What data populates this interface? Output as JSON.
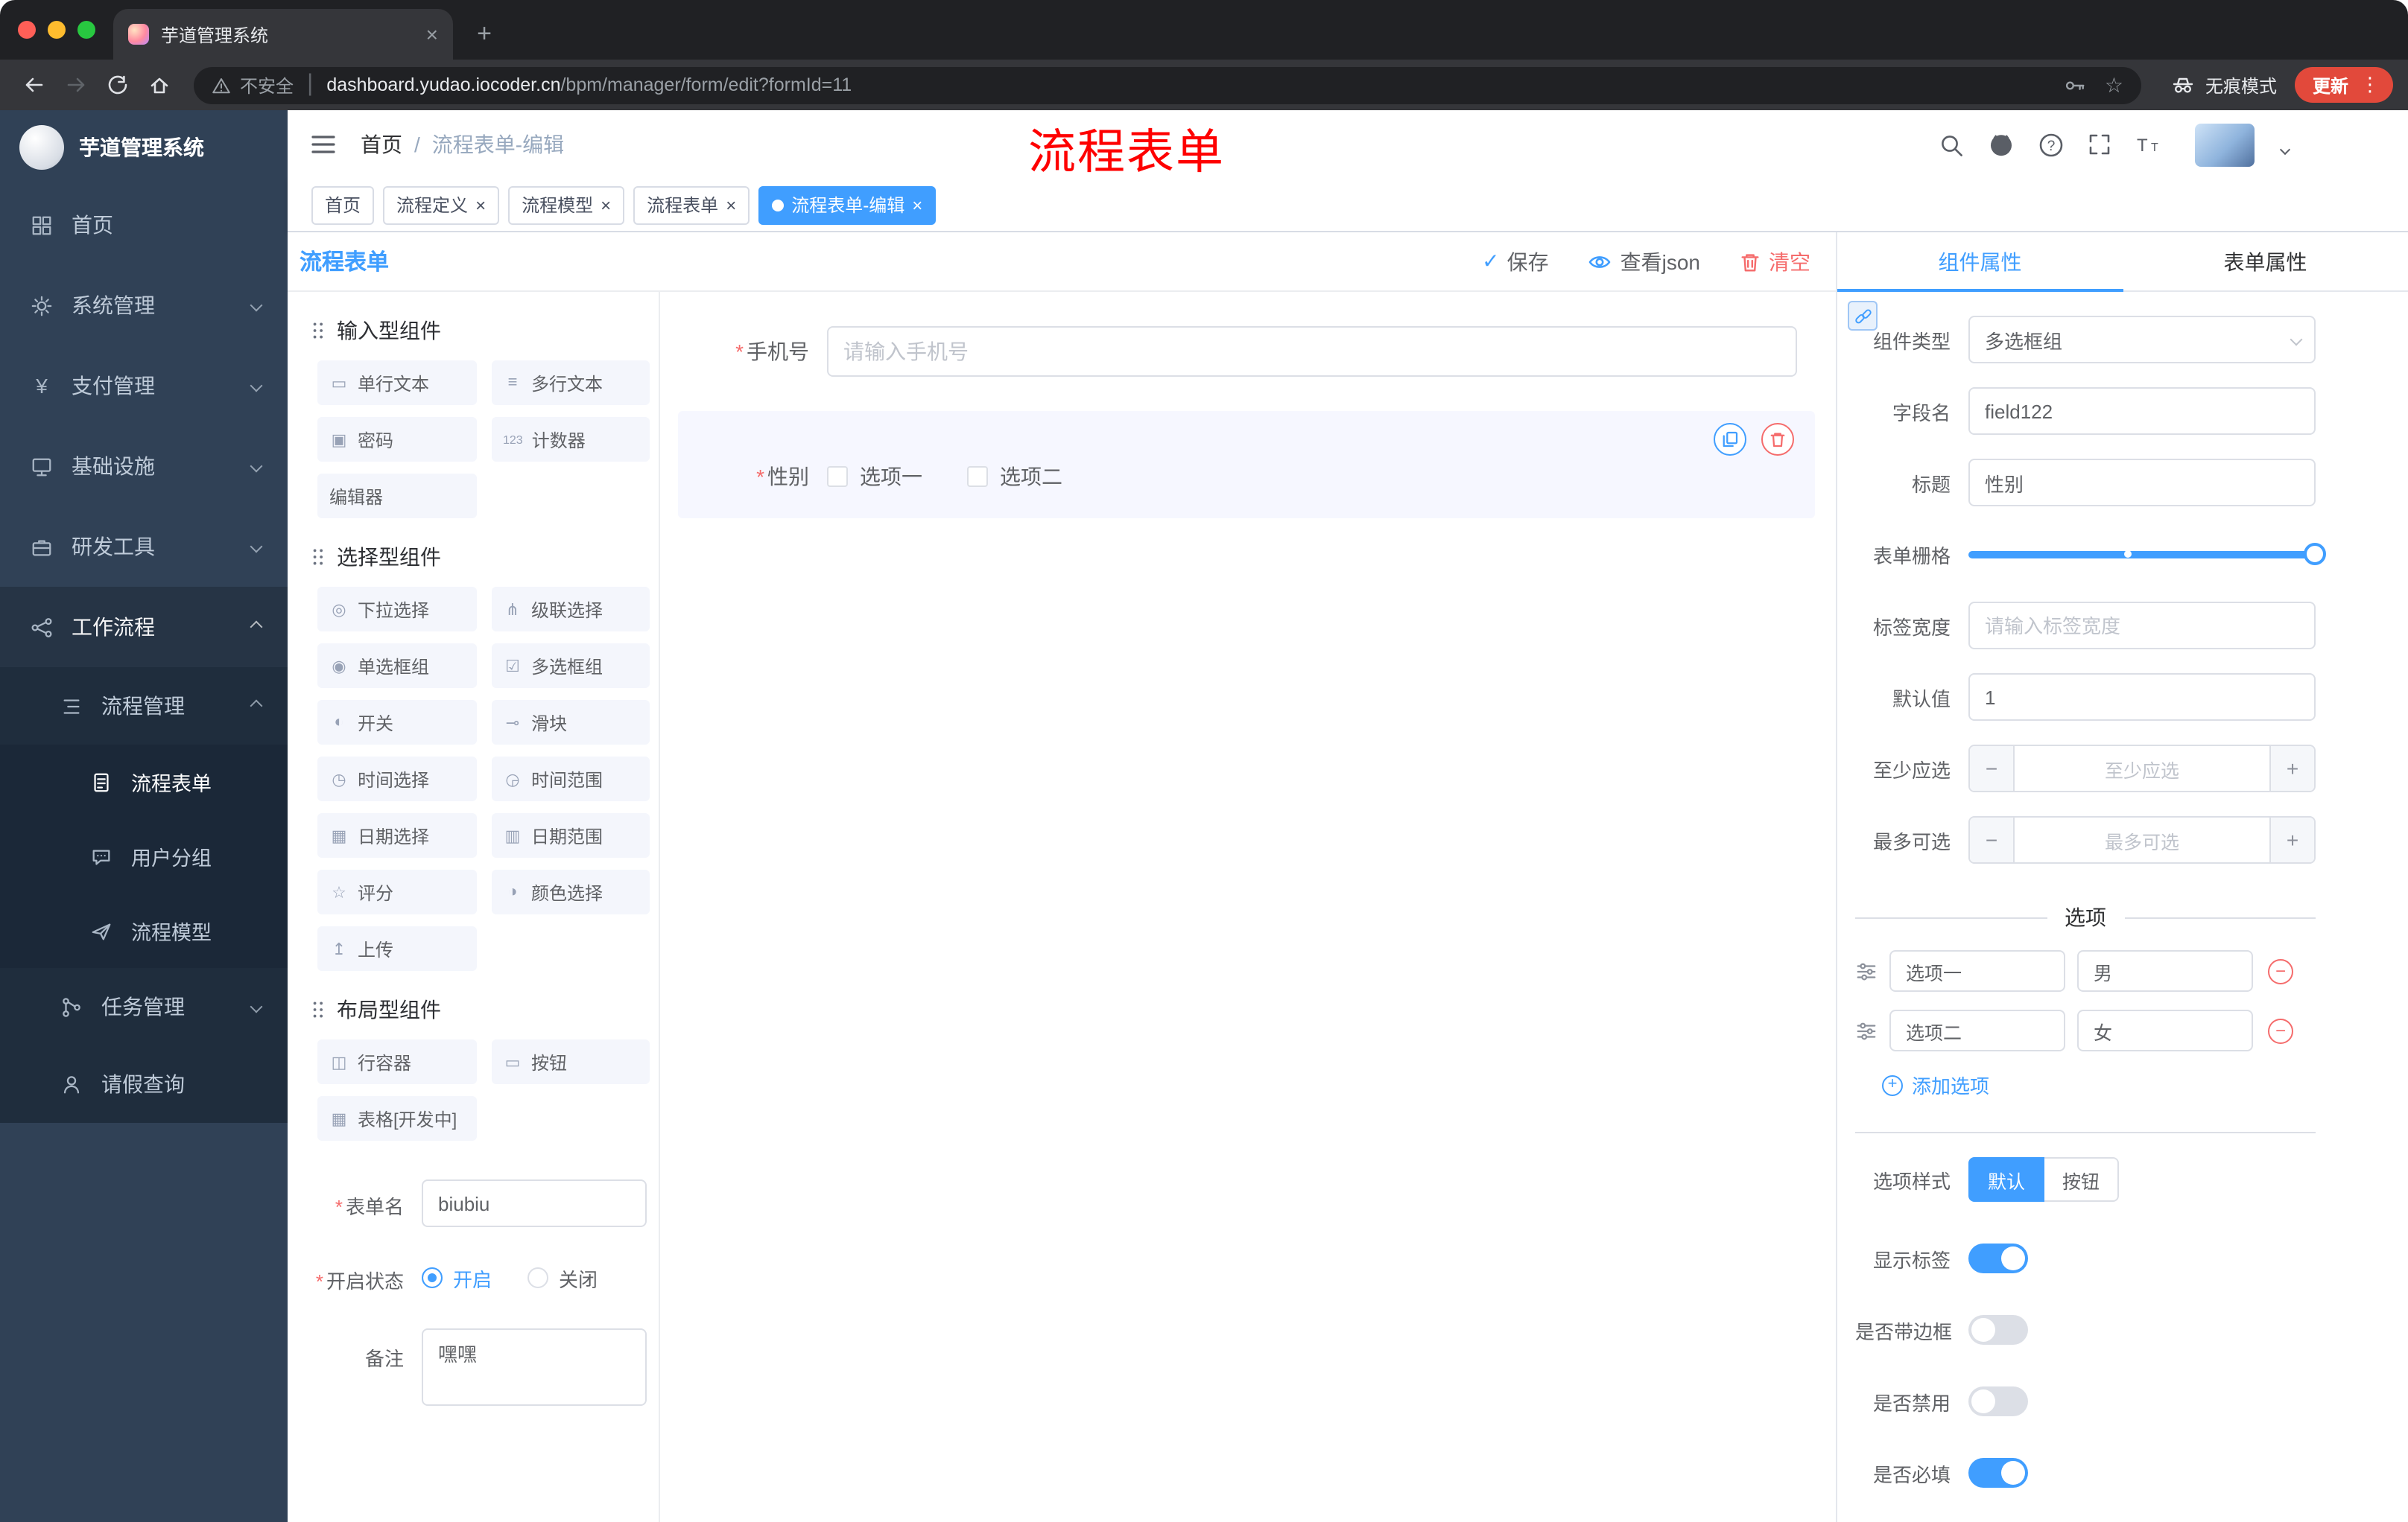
{
  "colors": {
    "accent": "#409EFF",
    "danger": "#F56C6C",
    "sidebar_bg": "#304156",
    "sidebar_sub_bg": "#1F2D3D",
    "update_button": "#E2493B",
    "annotation_red": "#FE0000",
    "selected_block_bg": "#F6F7FF"
  },
  "browser": {
    "tab_title": "芋道管理系统",
    "security_label": "不安全",
    "url_host": "dashboard.yudao.iocoder.cn",
    "url_path": "/bpm/manager/form/edit?formId=11",
    "incognito_label": "无痕模式",
    "update_label": "更新"
  },
  "sidebar": {
    "logo_title": "芋道管理系统",
    "items": [
      {
        "label": "首页",
        "icon": "dashboard"
      },
      {
        "label": "系统管理",
        "icon": "gear"
      },
      {
        "label": "支付管理",
        "icon": "yen"
      },
      {
        "label": "基础设施",
        "icon": "monitor"
      },
      {
        "label": "研发工具",
        "icon": "toolbox"
      },
      {
        "label": "工作流程",
        "icon": "workflow"
      },
      {
        "label": "流程管理",
        "icon": "process-list"
      },
      {
        "label": "流程表单",
        "icon": "form-document"
      },
      {
        "label": "用户分组",
        "icon": "user-group"
      },
      {
        "label": "流程模型",
        "icon": "paper-plane"
      },
      {
        "label": "任务管理",
        "icon": "branch"
      },
      {
        "label": "请假查询",
        "icon": "person"
      }
    ]
  },
  "header": {
    "breadcrumb_home": "首页",
    "breadcrumb_sep": "/",
    "breadcrumb_current": "流程表单-编辑",
    "annotation": "流程表单"
  },
  "tags": [
    {
      "label": "首页"
    },
    {
      "label": "流程定义"
    },
    {
      "label": "流程模型"
    },
    {
      "label": "流程表单"
    },
    {
      "label": "流程表单-编辑"
    }
  ],
  "designer": {
    "title": "流程表单",
    "save_label": "保存",
    "view_json_label": "查看json",
    "clear_label": "清空",
    "required_mark": "*",
    "palette": {
      "groups": [
        {
          "title": "输入型组件",
          "items": [
            {
              "label": "单行文本",
              "icon": "text-input",
              "glyph": "▭"
            },
            {
              "label": "多行文本",
              "icon": "textarea",
              "glyph": "≡"
            },
            {
              "label": "密码",
              "icon": "password",
              "glyph": "▣"
            },
            {
              "label": "计数器",
              "icon": "counter",
              "glyph": "123"
            },
            {
              "label": "编辑器",
              "icon": "editor",
              "glyph": ""
            }
          ]
        },
        {
          "title": "选择型组件",
          "items": [
            {
              "label": "下拉选择",
              "icon": "select",
              "glyph": "◎"
            },
            {
              "label": "级联选择",
              "icon": "cascader",
              "glyph": "⋔"
            },
            {
              "label": "单选框组",
              "icon": "radio-group",
              "glyph": "◉"
            },
            {
              "label": "多选框组",
              "icon": "checkbox-group",
              "glyph": "☑"
            },
            {
              "label": "开关",
              "icon": "switch",
              "glyph": "◐"
            },
            {
              "label": "滑块",
              "icon": "slider",
              "glyph": "⊸"
            },
            {
              "label": "时间选择",
              "icon": "time-picker",
              "glyph": "◷"
            },
            {
              "label": "时间范围",
              "icon": "time-range",
              "glyph": "◶"
            },
            {
              "label": "日期选择",
              "icon": "date-picker",
              "glyph": "▦"
            },
            {
              "label": "日期范围",
              "icon": "date-range",
              "glyph": "▥"
            },
            {
              "label": "评分",
              "icon": "rate",
              "glyph": "☆"
            },
            {
              "label": "颜色选择",
              "icon": "color-picker",
              "glyph": "◑"
            },
            {
              "label": "上传",
              "icon": "upload",
              "glyph": "↥"
            }
          ]
        },
        {
          "title": "布局型组件",
          "items": [
            {
              "label": "行容器",
              "icon": "row-container",
              "glyph": "◫"
            },
            {
              "label": "按钮",
              "icon": "button",
              "glyph": "▭"
            },
            {
              "label": "表格[开发中]",
              "icon": "table",
              "glyph": "▦"
            }
          ]
        }
      ]
    },
    "meta": {
      "form_name_label": "表单名",
      "form_name_value": "biubiu",
      "status_label": "开启状态",
      "status_on": "开启",
      "status_off": "关闭",
      "remark_label": "备注",
      "remark_value": "嘿嘿"
    },
    "canvas": {
      "phone_label": "手机号",
      "phone_placeholder": "请输入手机号",
      "gender_label": "性别",
      "gender_option1": "选项一",
      "gender_option2": "选项二"
    }
  },
  "props": {
    "tab_component": "组件属性",
    "tab_form": "表单属性",
    "component_type_label": "组件类型",
    "component_type_value": "多选框组",
    "field_name_label": "字段名",
    "field_name_value": "field122",
    "title_label": "标题",
    "title_value": "性别",
    "grid_label": "表单栅格",
    "label_width_label": "标签宽度",
    "label_width_placeholder": "请输入标签宽度",
    "default_label": "默认值",
    "default_value": "1",
    "min_label": "至少应选",
    "min_placeholder": "至少应选",
    "max_label": "最多可选",
    "max_placeholder": "最多可选",
    "options_title": "选项",
    "option_rows": [
      {
        "label": "选项一",
        "value": "男"
      },
      {
        "label": "选项二",
        "value": "女"
      }
    ],
    "add_option_label": "添加选项",
    "option_style_label": "选项样式",
    "style_default": "默认",
    "style_button": "按钮",
    "show_label_label": "显示标签",
    "border_label": "是否带边框",
    "disabled_label": "是否禁用",
    "required_label": "是否必填"
  }
}
